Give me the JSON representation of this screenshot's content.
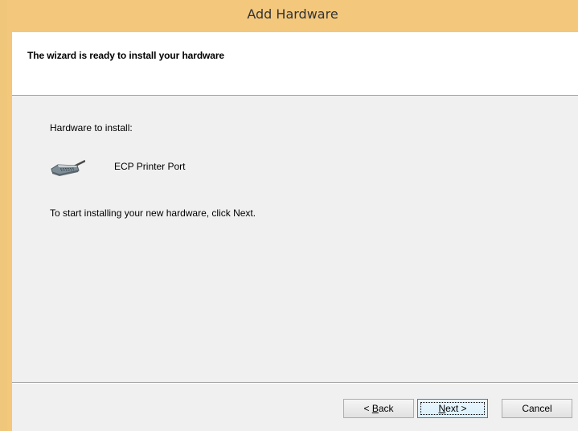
{
  "window": {
    "title": "Add Hardware"
  },
  "header": {
    "title": "The wizard is ready to install your hardware"
  },
  "body": {
    "hardware_label": "Hardware to install:",
    "device": {
      "icon": "parallel-port-icon",
      "name": "ECP Printer Port"
    },
    "instructions": "To start installing your new hardware, click Next."
  },
  "buttons": {
    "back": {
      "prefix": "< ",
      "mnemonic": "B",
      "rest": "ack"
    },
    "next": {
      "prefix": "",
      "mnemonic": "N",
      "rest": "ext >"
    },
    "cancel": "Cancel"
  },
  "colors": {
    "title_bar": "#f3c77c",
    "client_bg": "#f0f0f0",
    "header_bg": "#ffffff",
    "focus_border": "#3c7fb1"
  }
}
